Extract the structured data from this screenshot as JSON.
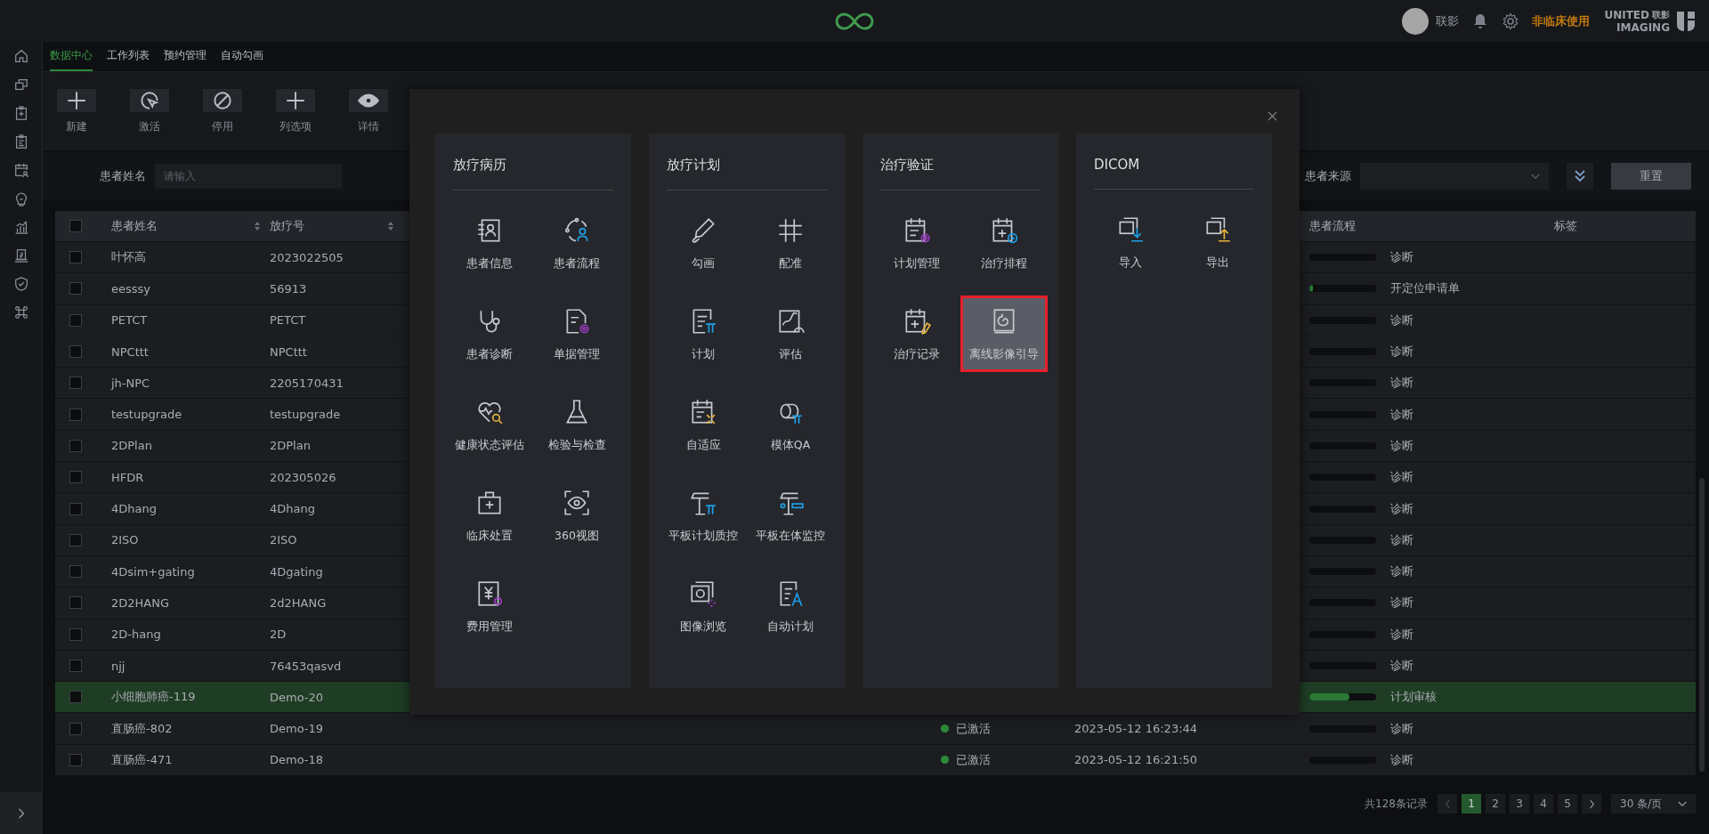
{
  "header": {
    "user": "联影",
    "usage_note": "非临床使用",
    "brand": {
      "line1": "UNITED",
      "line1_cn": "联影",
      "line2": "IMAGING"
    }
  },
  "nav_tabs": [
    {
      "label": "数据中心",
      "selected": true
    },
    {
      "label": "工作列表",
      "selected": false
    },
    {
      "label": "预约管理",
      "selected": false
    },
    {
      "label": "自动勾画",
      "selected": false
    }
  ],
  "toolbar": [
    {
      "label": "新建"
    },
    {
      "label": "激活"
    },
    {
      "label": "停用"
    },
    {
      "label": "列选项"
    },
    {
      "label": "详情"
    }
  ],
  "filters": {
    "name_field": {
      "label": "患者姓名",
      "placeholder": "请输入"
    },
    "source_field": {
      "label": "患者来源"
    },
    "reset_button": "重置"
  },
  "table": {
    "select_all_checked": false,
    "columns": [
      {
        "label": "患者姓名"
      },
      {
        "label": "放疗号"
      },
      {
        "label": "患者流程"
      },
      {
        "label": "标签"
      }
    ],
    "rows": [
      {
        "name": "叶怀高",
        "rt_number": "2023022505",
        "flow": "诊断",
        "level": 0,
        "checked": false,
        "selected": false
      },
      {
        "name": "eesssy",
        "rt_number": "56913",
        "flow": "开定位申请单",
        "level": 0.05,
        "checked": false,
        "selected": false
      },
      {
        "name": "PETCT",
        "rt_number": "PETCT",
        "flow": "诊断",
        "level": 0,
        "checked": false,
        "selected": false
      },
      {
        "name": "NPCttt",
        "rt_number": "NPCttt",
        "flow": "诊断",
        "level": 0,
        "checked": false,
        "selected": false
      },
      {
        "name": "jh-NPC",
        "rt_number": "2205170431",
        "flow": "诊断",
        "level": 0,
        "checked": false,
        "selected": false
      },
      {
        "name": "testupgrade",
        "rt_number": "testupgrade",
        "flow": "诊断",
        "level": 0,
        "checked": false,
        "selected": false
      },
      {
        "name": "2DPlan",
        "rt_number": "2DPlan",
        "flow": "诊断",
        "level": 0,
        "checked": false,
        "selected": false
      },
      {
        "name": "HFDR",
        "rt_number": "202305026",
        "flow": "诊断",
        "level": 0,
        "checked": false,
        "selected": false
      },
      {
        "name": "4Dhang",
        "rt_number": "4Dhang",
        "flow": "诊断",
        "level": 0,
        "checked": false,
        "selected": false
      },
      {
        "name": "2ISO",
        "rt_number": "2ISO",
        "flow": "诊断",
        "level": 0,
        "checked": false,
        "selected": false
      },
      {
        "name": "4Dsim+gating",
        "rt_number": "4Dgating",
        "flow": "诊断",
        "level": 0,
        "checked": false,
        "selected": false
      },
      {
        "name": "2D2HANG",
        "rt_number": "2d2HANG",
        "flow": "诊断",
        "level": 0,
        "checked": false,
        "selected": false
      },
      {
        "name": "2D-hang",
        "rt_number": "2D",
        "flow": "诊断",
        "level": 0,
        "checked": false,
        "selected": false
      },
      {
        "name": "njj",
        "rt_number": "76453qasvd",
        "flow": "诊断",
        "level": 0,
        "checked": false,
        "selected": false
      },
      {
        "name": "小细胞肺癌-119",
        "rt_number": "Demo-20",
        "flow": "计划审核",
        "level": 0.6,
        "checked": false,
        "selected": true
      },
      {
        "name": "直肠癌-802",
        "rt_number": "Demo-19",
        "status": "已激活",
        "date": "2023-05-12 16:23:44",
        "flow": "诊断",
        "level": 0,
        "checked": false,
        "selected": false
      },
      {
        "name": "直肠癌-471",
        "rt_number": "Demo-18",
        "status": "已激活",
        "date": "2023-05-12 16:21:50",
        "flow": "诊断",
        "level": 0,
        "checked": false,
        "selected": false
      }
    ]
  },
  "pagination": {
    "total": "共128条记录",
    "pages": [
      {
        "label": "1",
        "selected": true
      },
      {
        "label": "2",
        "selected": false
      },
      {
        "label": "3",
        "selected": false
      },
      {
        "label": "4",
        "selected": false
      },
      {
        "label": "5",
        "selected": false
      }
    ],
    "page_size": "30 条/页"
  },
  "modal": {
    "panels": [
      {
        "title": "放疗病历",
        "items": [
          {
            "label": "患者信息",
            "selected": false
          },
          {
            "label": "患者流程",
            "selected": false
          },
          {
            "label": "患者诊断",
            "selected": false
          },
          {
            "label": "单据管理",
            "selected": false
          },
          {
            "label": "健康状态评估",
            "selected": false
          },
          {
            "label": "检验与检查",
            "selected": false
          },
          {
            "label": "临床处置",
            "selected": false
          },
          {
            "label": "360视图",
            "selected": false
          },
          {
            "label": "费用管理",
            "selected": false
          }
        ]
      },
      {
        "title": "放疗计划",
        "items": [
          {
            "label": "勾画",
            "selected": false
          },
          {
            "label": "配准",
            "selected": false
          },
          {
            "label": "计划",
            "selected": false
          },
          {
            "label": "评估",
            "selected": false
          },
          {
            "label": "自适应",
            "selected": false
          },
          {
            "label": "模体QA",
            "selected": false
          },
          {
            "label": "平板计划质控",
            "selected": false
          },
          {
            "label": "平板在体监控",
            "selected": false
          },
          {
            "label": "图像浏览",
            "selected": false
          },
          {
            "label": "自动计划",
            "selected": false
          }
        ]
      },
      {
        "title": "治疗验证",
        "items": [
          {
            "label": "计划管理",
            "selected": false
          },
          {
            "label": "治疗排程",
            "selected": false
          },
          {
            "label": "治疗记录",
            "selected": false
          },
          {
            "label": "离线影像引导",
            "selected": true
          }
        ]
      },
      {
        "title": "DICOM",
        "items": [
          {
            "label": "导入",
            "selected": false
          },
          {
            "label": "导出",
            "selected": false
          }
        ]
      }
    ]
  }
}
